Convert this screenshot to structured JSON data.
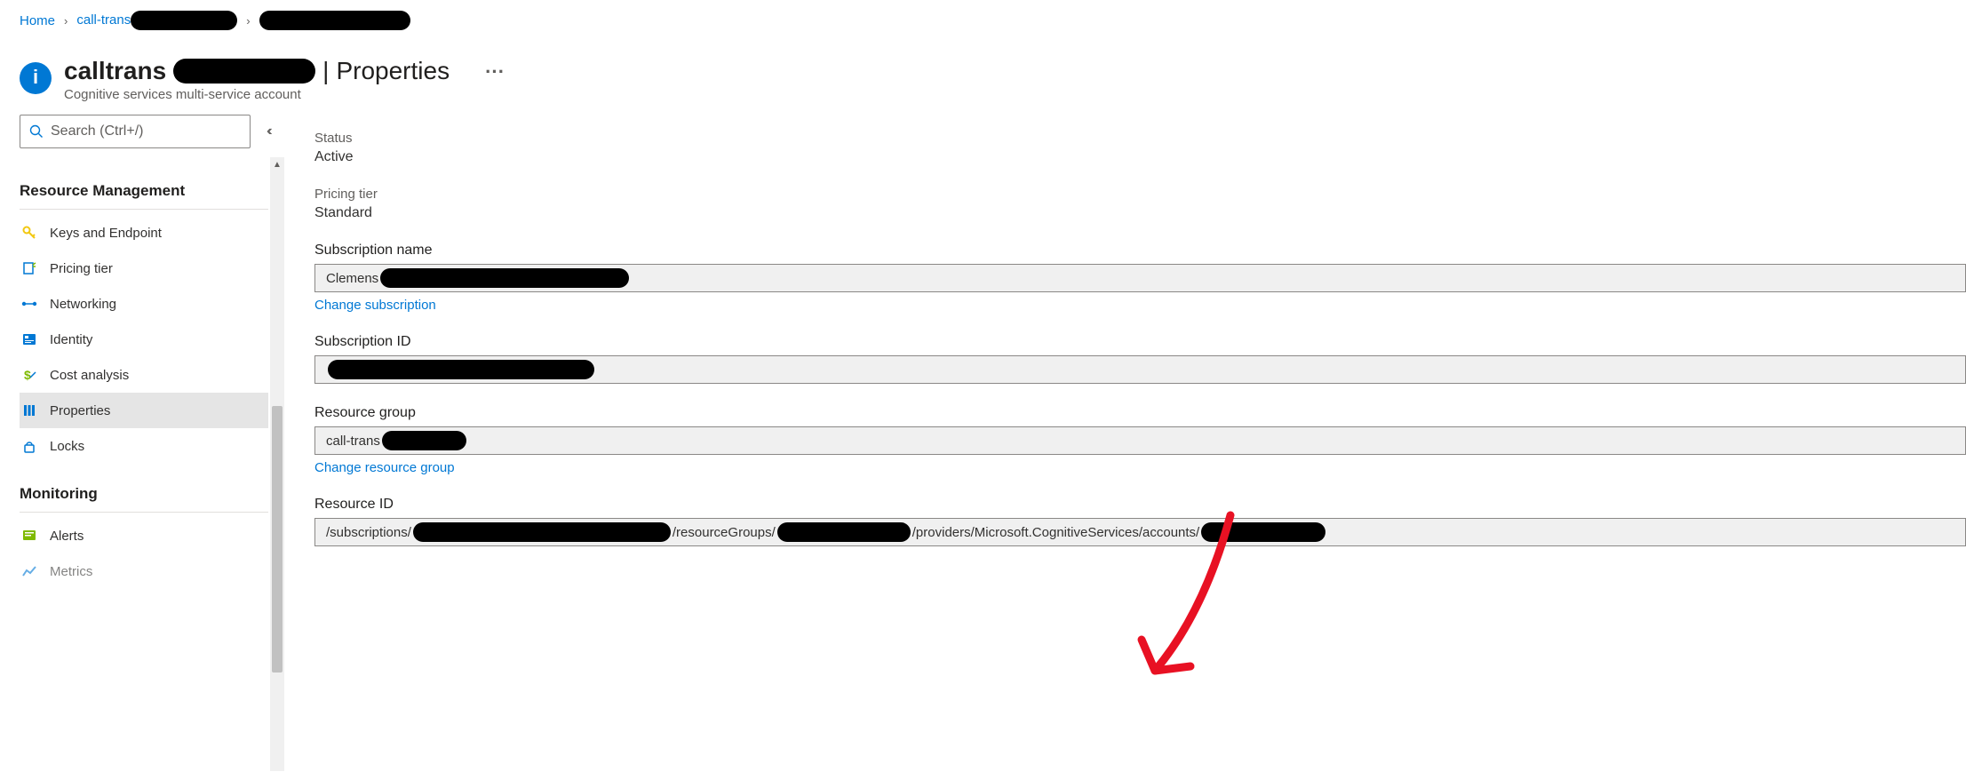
{
  "breadcrumb": {
    "home": "Home",
    "level1_prefix": "call-trans"
  },
  "header": {
    "title_prefix": "calltrans",
    "title_sep": " | ",
    "title_page": "Properties",
    "subtitle": "Cognitive services multi-service account"
  },
  "search": {
    "placeholder": "Search (Ctrl+/)"
  },
  "sidebar": {
    "section_resource": "Resource Management",
    "section_monitoring": "Monitoring",
    "items": {
      "keys": "Keys and Endpoint",
      "pricing": "Pricing tier",
      "networking": "Networking",
      "identity": "Identity",
      "cost": "Cost analysis",
      "properties": "Properties",
      "locks": "Locks",
      "alerts": "Alerts",
      "metrics": "Metrics"
    }
  },
  "properties": {
    "status_label": "Status",
    "status_value": "Active",
    "pricing_label": "Pricing tier",
    "pricing_value": "Standard",
    "sub_name_label": "Subscription name",
    "sub_name_prefix": "Clemens ",
    "change_subscription": "Change subscription",
    "sub_id_label": "Subscription ID",
    "rg_label": "Resource group",
    "rg_prefix": "call-trans",
    "change_rg": "Change resource group",
    "rid_label": "Resource ID",
    "rid_seg1": "/subscriptions/",
    "rid_seg2": "/resourceGroups/",
    "rid_seg3": "/providers/Microsoft.CognitiveServices/accounts/"
  }
}
